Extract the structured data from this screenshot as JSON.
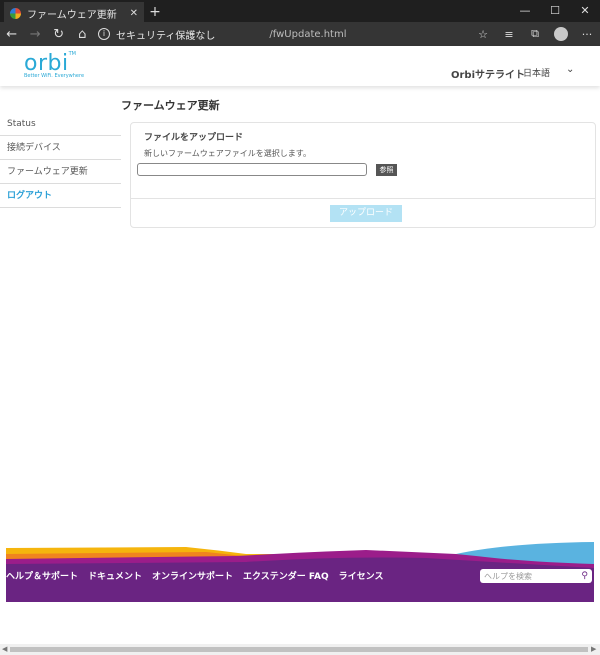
{
  "browser": {
    "tab_title": "ファームウェア更新",
    "tab_close": "✕",
    "new_tab": "+",
    "security_label": "セキュリティ保護なし",
    "url": "/fwUpdate.html"
  },
  "header": {
    "logo_word": "orbi",
    "logo_tm": "TM",
    "logo_tagline": "Better WiFi. Everywhere",
    "satellite_label": "Orbiサテライト",
    "language": "日本語"
  },
  "page": {
    "title": "ファームウェア更新"
  },
  "sidebar": {
    "items": [
      {
        "label": "Status"
      },
      {
        "label": "接続デバイス"
      },
      {
        "label": "ファームウェア更新"
      },
      {
        "label": "ログアウト"
      }
    ]
  },
  "upload_panel": {
    "heading": "ファイルをアップロード",
    "description": "新しいファームウェアファイルを選択します。",
    "file_value": "",
    "browse_label": "参照",
    "upload_label": "アップロード"
  },
  "footer": {
    "links": [
      {
        "label": "ヘルプ＆サポート"
      },
      {
        "label": "ドキュメント"
      },
      {
        "label": "オンラインサポート"
      },
      {
        "label": "エクステンダー FAQ"
      },
      {
        "label": "ライセンス"
      }
    ],
    "search_placeholder": "ヘルプを検索"
  },
  "colors": {
    "accent": "#2aa9d6",
    "footer_purple": "#6a2482",
    "footer_yellow": "#f5b50d",
    "footer_orange": "#f0841e",
    "footer_magenta": "#9b1d8a",
    "footer_blue": "#5ab3e0"
  }
}
